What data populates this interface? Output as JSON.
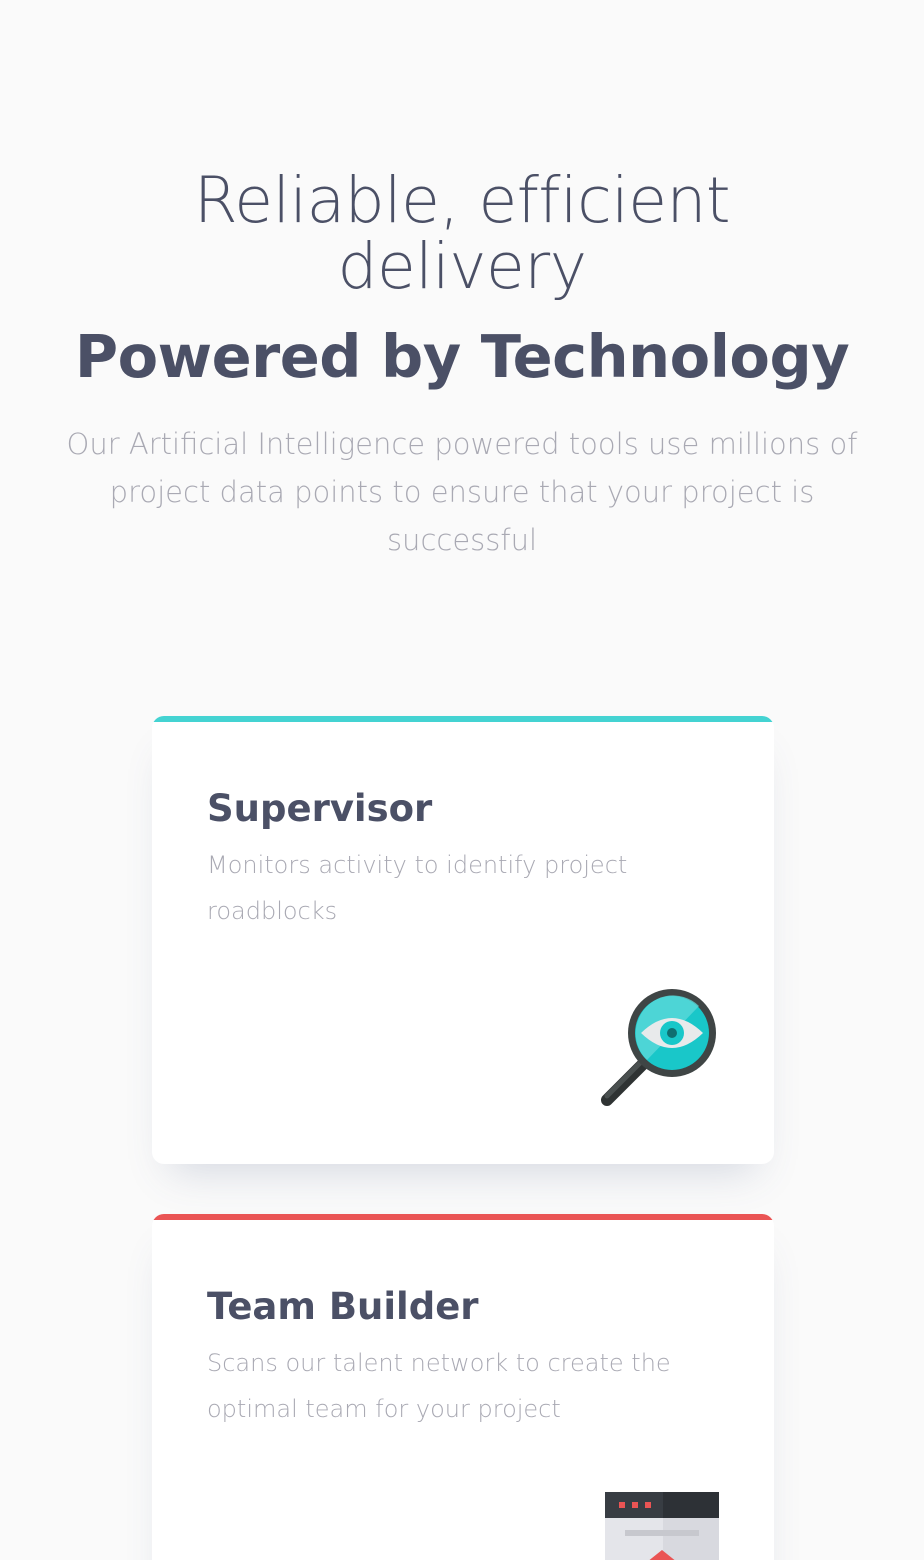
{
  "hero": {
    "line1": "Reliable, efficient delivery",
    "line2": "Powered by Technology",
    "subtitle": "Our Artificial Intelligence powered tools use millions of project data points to ensure that your project is successful"
  },
  "cards": [
    {
      "title": "Supervisor",
      "description": "Monitors activity to identify project roadblocks",
      "accent_color": "#44d3d2",
      "icon": "magnifier-eye-icon"
    },
    {
      "title": "Team Builder",
      "description": "Scans our talent network to create the optimal team for your project",
      "accent_color": "#ea5454",
      "icon": "team-builder-document-icon"
    }
  ],
  "colors": {
    "heading": "#4b5066",
    "muted_text": "#a9a9b3",
    "background": "#fafafa",
    "cyan": "#44d3d2",
    "red": "#ea5454"
  }
}
